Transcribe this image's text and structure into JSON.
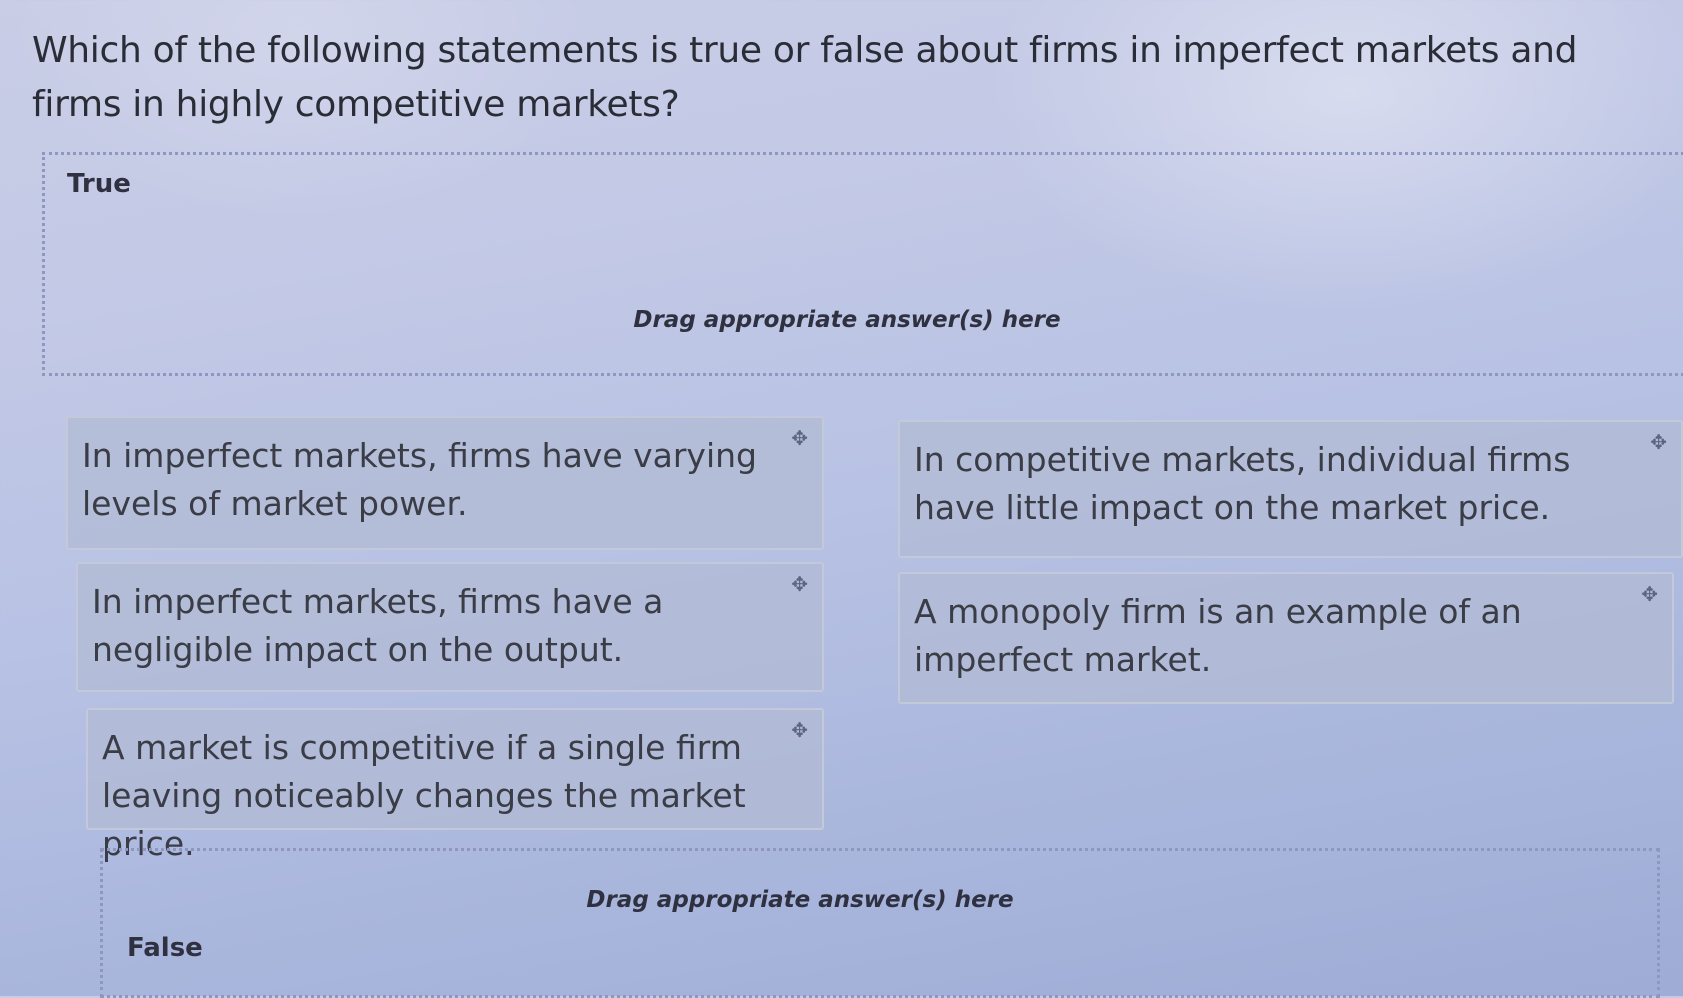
{
  "question": "Which of the following statements is true or false about firms in imperfect markets and firms in highly competitive markets?",
  "drop_zones": {
    "true_zone": {
      "label": "True",
      "hint": "Drag appropriate answer(s) here"
    },
    "false_zone": {
      "label": "False",
      "hint": "Drag appropriate answer(s) here"
    }
  },
  "cards": [
    {
      "text": "In imperfect markets, firms have varying levels of market power.",
      "icon": "move-icon"
    },
    {
      "text": "In competitive markets, individual firms have little impact on the market price.",
      "icon": "move-icon"
    },
    {
      "text": "In imperfect markets, firms have a negligible impact on the output.",
      "icon": "move-icon"
    },
    {
      "text": "A monopoly firm is an example of an imperfect market.",
      "icon": "move-icon"
    },
    {
      "text": "A market is competitive if a single firm leaving noticeably changes the market price.",
      "icon": "move-icon"
    }
  ],
  "colors": {
    "background": "#b8c2e4",
    "card": "#b1bbd4",
    "dropzone_border": "#8e97bf"
  }
}
